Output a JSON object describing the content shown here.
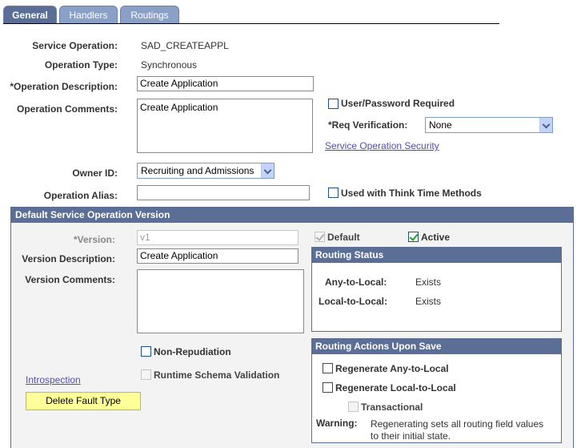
{
  "tabs": [
    {
      "label": "General",
      "active": true
    },
    {
      "label": "Handlers",
      "active": false
    },
    {
      "label": "Routings",
      "active": false
    }
  ],
  "general": {
    "service_operation_label": "Service Operation:",
    "service_operation_value": "SAD_CREATEAPPL",
    "operation_type_label": "Operation Type:",
    "operation_type_value": "Synchronous",
    "operation_description_label": "*Operation Description:",
    "operation_description_value": "Create Application",
    "operation_comments_label": "Operation Comments:",
    "operation_comments_value": "Create Application",
    "user_password_label": "User/Password Required",
    "req_verification_label": "*Req Verification:",
    "req_verification_value": "None",
    "security_link": "Service Operation Security",
    "owner_id_label": "Owner ID:",
    "owner_id_value": "Recruiting and Admissions",
    "operation_alias_label": "Operation Alias:",
    "operation_alias_value": "",
    "think_time_label": "Used with Think Time Methods"
  },
  "version_section": {
    "title": "Default Service Operation Version",
    "version_label": "*Version:",
    "version_value": "v1",
    "default_label": "Default",
    "active_label": "Active",
    "version_description_label": "Version Description:",
    "version_description_value": "Create Application",
    "version_comments_label": "Version Comments:",
    "version_comments_value": "",
    "non_repudiation_label": "Non-Repudiation",
    "runtime_schema_label": "Runtime Schema Validation",
    "introspection_link": "Introspection",
    "delete_fault_button": "Delete Fault Type",
    "routing_status": {
      "title": "Routing Status",
      "any_to_local_label": "Any-to-Local:",
      "any_to_local_value": "Exists",
      "local_to_local_label": "Local-to-Local:",
      "local_to_local_value": "Exists"
    },
    "routing_actions": {
      "title": "Routing Actions Upon Save",
      "regen_any_label": "Regenerate Any-to-Local",
      "regen_local_label": "Regenerate Local-to-Local",
      "transactional_label": "Transactional",
      "warning_label": "Warning:",
      "warning_line1": "Regenerating sets all routing field values",
      "warning_line2": "to their initial state."
    }
  }
}
